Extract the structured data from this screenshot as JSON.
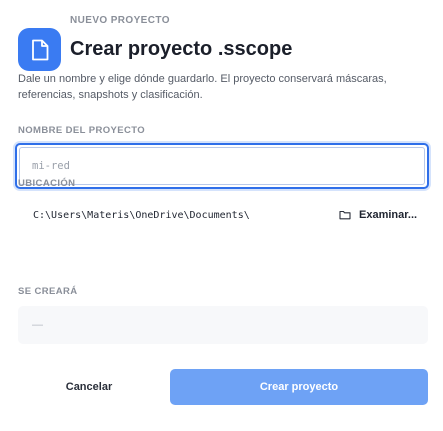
{
  "header": {
    "eyebrow": "NUEVO PROYECTO",
    "title": "Crear proyecto .sscope",
    "icon": "file-icon"
  },
  "description": "Dale un nombre y elige dónde guardarlo. El proyecto conservará máscaras, referencias, snapshots y clasificación.",
  "name_section": {
    "label": "NOMBRE DEL PROYECTO",
    "value": "",
    "placeholder": "mi-red"
  },
  "location_section": {
    "label": "UBICACIÓN",
    "path": "C:\\Users\\Materis\\OneDrive\\Documents\\",
    "browse_label": "Examinar..."
  },
  "create_section": {
    "label": "SE CREARÁ",
    "preview": "—"
  },
  "actions": {
    "cancel_label": "Cancelar",
    "create_label": "Crear proyecto"
  },
  "colors": {
    "accent": "#3a7bf2",
    "primary_button": "#6ea2f5",
    "focus_border": "#2f6fe9"
  }
}
